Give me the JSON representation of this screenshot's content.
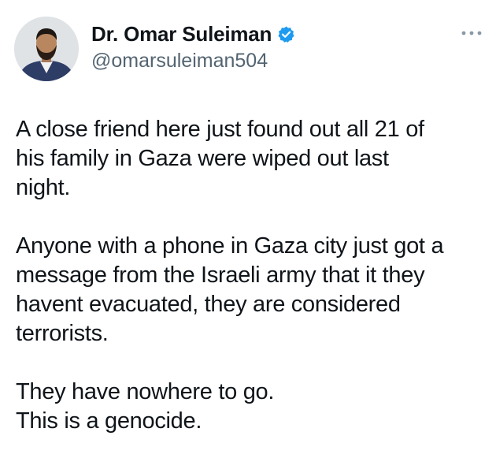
{
  "author": {
    "display_name": "Dr. Omar Suleiman",
    "handle": "@omarsuleiman504",
    "verified": true,
    "avatar_icon": "profile-photo",
    "verified_icon": "verified-badge-icon",
    "verified_color": "#1d9bf0"
  },
  "menu": {
    "icon": "more-options-icon"
  },
  "tweet": {
    "paragraphs": [
      {
        "lines": [
          "A close friend here just found out all 21 of",
          "his family in Gaza were wiped out last",
          "night."
        ]
      },
      {
        "lines": [
          "Anyone with a phone in Gaza city just got a",
          "message from the Israeli army that it they",
          "havent evacuated, they are considered",
          "terrorists."
        ]
      },
      {
        "lines": [
          "They have nowhere to go.",
          "This is a genocide."
        ]
      }
    ]
  },
  "colors": {
    "text": "#0f1419",
    "secondary_text": "#536471",
    "background": "#ffffff"
  }
}
